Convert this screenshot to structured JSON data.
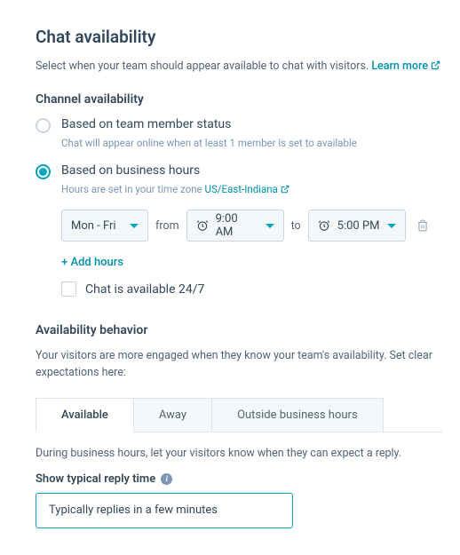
{
  "title": "Chat availability",
  "description": "Select when your team should appear available to chat with visitors. ",
  "learn_more": "Learn more",
  "channel": {
    "heading": "Channel availability",
    "team_status_label": "Based on team member status",
    "team_status_sub": "Chat will appear online when at least 1 member is set to available",
    "business_hours_label": "Based on business hours",
    "business_hours_sub_prefix": "Hours are set in your time zone ",
    "timezone": "US/East-Indiana",
    "days": "Mon - Fri",
    "from": "from",
    "start": "9:00 AM",
    "to": "to",
    "end": "5:00 PM",
    "add_hours": "+ Add hours",
    "always_label": "Chat is available 24/7"
  },
  "behavior": {
    "heading": "Availability behavior",
    "description": "Your visitors are more engaged when they know your team's availability. Set clear expectations here:",
    "tabs": {
      "available": "Available",
      "away": "Away",
      "outside": "Outside business hours"
    },
    "tab_content_desc": "During business hours, let your visitors know when they can expect a reply.",
    "reply_label": "Show typical reply time",
    "reply_value": "Typically replies in a few minutes"
  }
}
